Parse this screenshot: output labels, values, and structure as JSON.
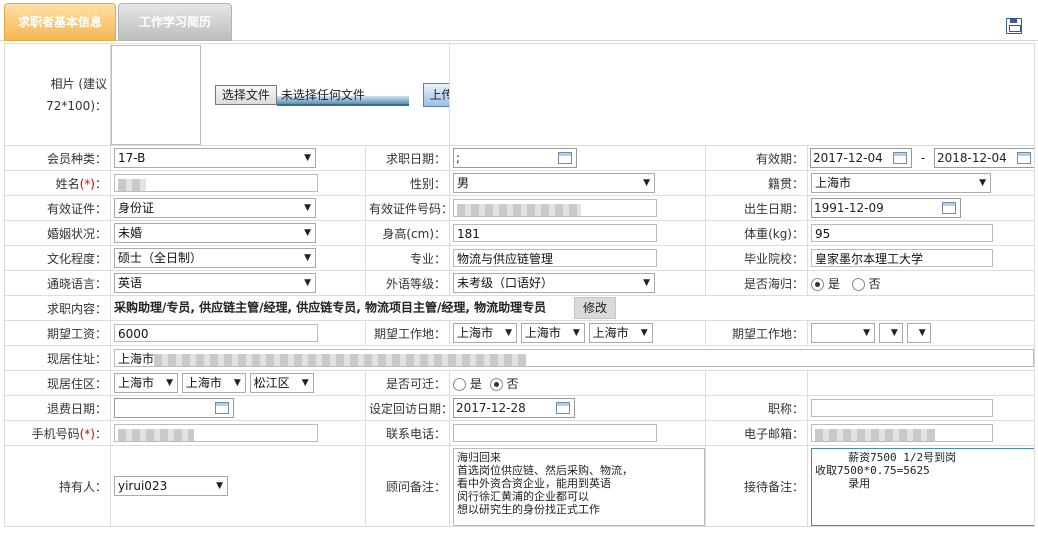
{
  "tabs": [
    "求职者基本信息",
    "工作学习简历"
  ],
  "photo": {
    "label": "相片 (建议 72*100)：",
    "choose_btn": "选择文件",
    "no_file": "未选择任何文件",
    "upload_btn": "上传"
  },
  "member_type": {
    "label": "会员种类：",
    "value": "17-B"
  },
  "apply_date": {
    "label": "求职日期：",
    "value": ";"
  },
  "valid_period": {
    "label": "有效期：",
    "from": "2017-12-04",
    "sep": "-",
    "to": "2018-12-04"
  },
  "name": {
    "label": "姓名",
    "req": "(*)",
    "colon": "："
  },
  "gender": {
    "label": "性别：",
    "value": "男"
  },
  "native_place": {
    "label": "籍贯：",
    "value": "上海市"
  },
  "id_type": {
    "label": "有效证件：",
    "value": "身份证"
  },
  "id_number": {
    "label": "有效证件号码："
  },
  "birth_date": {
    "label": "出生日期：",
    "value": "1991-12-09"
  },
  "marital": {
    "label": "婚姻状况：",
    "value": "未婚"
  },
  "height": {
    "label": "身高(cm)：",
    "value": "181"
  },
  "weight": {
    "label": "体重(kg)：",
    "value": "95"
  },
  "education": {
    "label": "文化程度：",
    "value": "硕士（全日制）"
  },
  "major": {
    "label": "专业：",
    "value": "物流与供应链管理"
  },
  "school": {
    "label": "毕业院校：",
    "value": "皇家墨尔本理工大学"
  },
  "language": {
    "label": "通晓语言：",
    "value": "英语"
  },
  "foreign_level": {
    "label": "外语等级：",
    "value": "未考级（口语好）"
  },
  "overseas": {
    "label": "是否海归：",
    "yes": "是",
    "no": "否",
    "selected": "yes"
  },
  "job_content": {
    "label": "求职内容：",
    "value": "采购助理/专员, 供应链主管/经理, 供应链专员, 物流项目主管/经理, 物流助理专员",
    "modify_btn": "修改"
  },
  "salary": {
    "label": "期望工资：",
    "value": "6000"
  },
  "work_place1": {
    "label": "期望工作地：",
    "v1": "上海市",
    "v2": "上海市",
    "v3": "上海市"
  },
  "work_place2": {
    "label": "期望工作地："
  },
  "address": {
    "label": "现居住址：",
    "value": "上海市"
  },
  "district": {
    "label": "现居住区：",
    "v1": "上海市",
    "v2": "上海市",
    "v3": "松江区"
  },
  "relocate": {
    "label": "是否可迁：",
    "yes": "是",
    "no": "否",
    "selected": "no"
  },
  "refund_date": {
    "label": "退费日期："
  },
  "revisit_date": {
    "label": "设定回访日期：",
    "value": "2017-12-28"
  },
  "title": {
    "label": "职称："
  },
  "mobile": {
    "label": "手机号码",
    "req": "(*)",
    "colon": "："
  },
  "phone": {
    "label": "联系电话："
  },
  "email": {
    "label": "电子邮箱："
  },
  "holder": {
    "label": "持有人：",
    "value": "yirui023"
  },
  "advisor_note": {
    "label": "顾问备注：",
    "value": "海归回来\n首选岗位供应链、然后采购、物流，\n看中外资合资企业，能用到英语\n闵行徐汇黄浦的企业都可以\n想以研究生的身份找正式工作"
  },
  "reception_note": {
    "label": "接待备注：",
    "value": "     薪资7500 1/2号到岗\n收取7500*0.75=5625\n     录用"
  }
}
